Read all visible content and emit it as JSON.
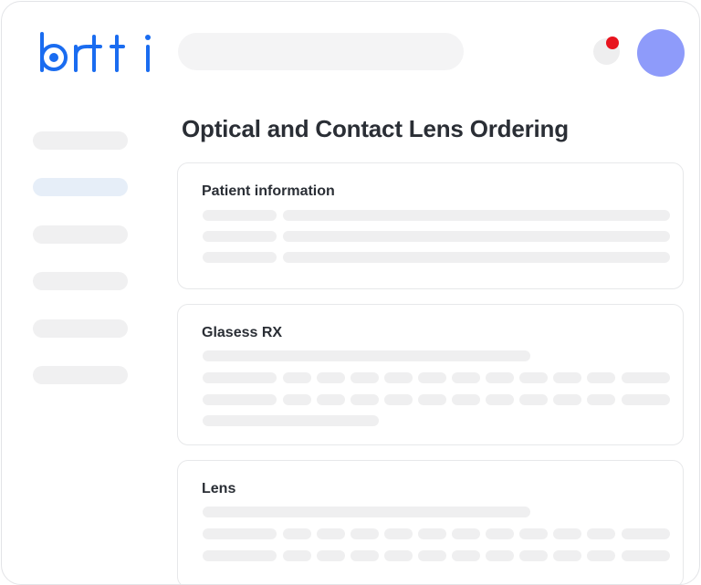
{
  "brand": {
    "logo_text": "barti",
    "accent": "#1a6cf0"
  },
  "header": {
    "search_placeholder": "",
    "notification": {
      "icon": "bell-icon",
      "dot_color": "#e8141e"
    },
    "avatar_color": "#8e9bfa"
  },
  "page": {
    "title": "Optical and Contact Lens Ordering"
  },
  "sections": [
    {
      "title": "Patient information"
    },
    {
      "title": "Glasess RX"
    },
    {
      "title": "Lens"
    }
  ]
}
